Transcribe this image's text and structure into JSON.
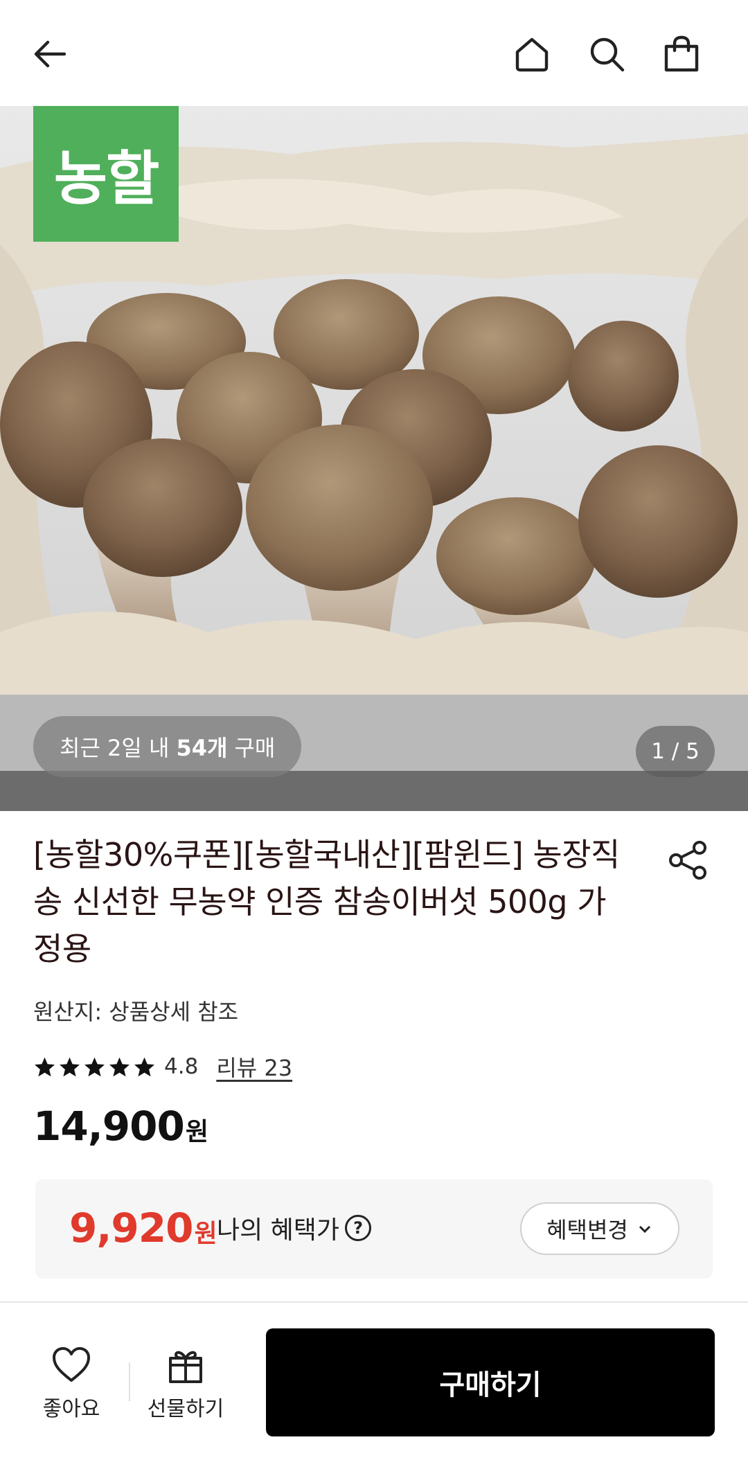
{
  "header": {
    "back_icon": "arrow-left-icon",
    "home_icon": "home-icon",
    "search_icon": "search-icon",
    "cart_icon": "shopping-bag-icon"
  },
  "hero": {
    "brand_logo_text": "농할",
    "recent_prefix": "최근 2일 내",
    "recent_count": "54개",
    "recent_suffix": "구매",
    "page_counter": "1 / 5"
  },
  "product": {
    "title": "[농할30%쿠폰][농할국내산][팜윈드] 농장직송 신선한 무농약 인증 참송이버섯 500g 가정용",
    "share_icon": "share-icon",
    "origin": "원산지: 상품상세 참조",
    "rating": 4.8,
    "rating_text": "4.8",
    "stars": 5,
    "review_link": "리뷰 23",
    "price": "14,900",
    "price_unit": "원"
  },
  "benefit": {
    "price": "9,920",
    "price_unit": "원",
    "label": "나의 혜택가",
    "help_icon": "question-circle-icon",
    "change_button": "혜택변경"
  },
  "bottom_bar": {
    "like_label": "좋아요",
    "gift_label": "선물하기",
    "buy_label": "구매하기"
  },
  "colors": {
    "brand_green": "#4faf5a",
    "benefit_red": "#e03a2d",
    "buy_button": "#000000"
  }
}
